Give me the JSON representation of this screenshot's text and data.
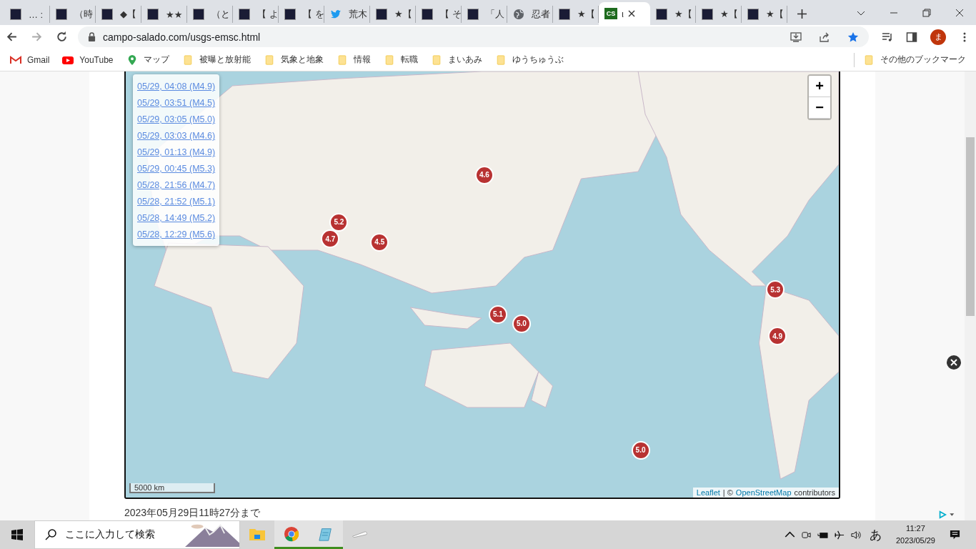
{
  "tabs": [
    {
      "title": "… :",
      "kind": "dark",
      "selected": false
    },
    {
      "title": "（時",
      "kind": "dark",
      "selected": false
    },
    {
      "title": "◆【",
      "kind": "dark",
      "selected": false
    },
    {
      "title": "★★",
      "kind": "dark",
      "selected": false
    },
    {
      "title": "（と",
      "kind": "dark",
      "selected": false
    },
    {
      "title": "【 よ",
      "kind": "dark",
      "selected": false
    },
    {
      "title": "【 を",
      "kind": "dark",
      "selected": false
    },
    {
      "title": "荒木",
      "kind": "twitter",
      "selected": false
    },
    {
      "title": "★【",
      "kind": "dark",
      "selected": false
    },
    {
      "title": "【 そ",
      "kind": "dark",
      "selected": false
    },
    {
      "title": "「人",
      "kind": "dark",
      "selected": false
    },
    {
      "title": "忍者",
      "kind": "globe",
      "selected": false
    },
    {
      "title": "★【",
      "kind": "dark",
      "selected": false
    },
    {
      "title": "ι",
      "kind": "cs",
      "badge": "CS",
      "selected": true
    },
    {
      "title": "★【",
      "kind": "dark",
      "selected": false
    },
    {
      "title": "★【",
      "kind": "dark",
      "selected": false
    },
    {
      "title": "★【",
      "kind": "dark",
      "selected": false
    }
  ],
  "address": "campo-salado.com/usgs-emsc.html",
  "bookmarks": [
    {
      "label": "Gmail",
      "kind": "gmail"
    },
    {
      "label": "YouTube",
      "kind": "youtube"
    },
    {
      "label": "マップ",
      "kind": "maps"
    },
    {
      "label": "被曝と放射能",
      "kind": "folder"
    },
    {
      "label": "気象と地象",
      "kind": "folder"
    },
    {
      "label": "情報",
      "kind": "folder"
    },
    {
      "label": "転職",
      "kind": "folder"
    },
    {
      "label": "まいあみ",
      "kind": "folder"
    },
    {
      "label": "ゆうちゅうぶ",
      "kind": "folder"
    }
  ],
  "other_bookmarks": "その他のブックマーク",
  "profile_initial": "ま",
  "map": {
    "events": [
      "05/29, 04:08 (M4.9)",
      "05/29, 03:51 (M4.5)",
      "05/29, 03:05 (M5.0)",
      "05/29, 03:03 (M4.6)",
      "05/29, 01:13 (M4.9)",
      "05/29, 00:45 (M5.3)",
      "05/28, 21:56 (M4.7)",
      "05/28, 21:52 (M5.1)",
      "05/28, 14:49 (M5.2)",
      "05/28, 12:29 (M5.6)"
    ],
    "markers": [
      "4.6",
      "4.7",
      "5.2",
      "4.5",
      "5.3",
      "5.1",
      "5.0",
      "4.9",
      "5.0"
    ],
    "zoom_in": "+",
    "zoom_out": "−",
    "scale": "5000 km",
    "attribution": {
      "leaflet": "Leaflet",
      "separator": "| ©",
      "osm": "OpenStreetMap",
      "rest": "contributors"
    }
  },
  "updated": "2023年05月29日11時27分まで",
  "taskbar": {
    "search_placeholder": "ここに入力して検索",
    "apps": [
      {
        "kind": "explorer",
        "running": false
      },
      {
        "kind": "chrome",
        "running": true
      },
      {
        "kind": "notepad",
        "running": true
      },
      {
        "kind": "pen",
        "running": false
      }
    ],
    "ime": "あ",
    "time": "11:27",
    "date": "2023/05/29"
  }
}
